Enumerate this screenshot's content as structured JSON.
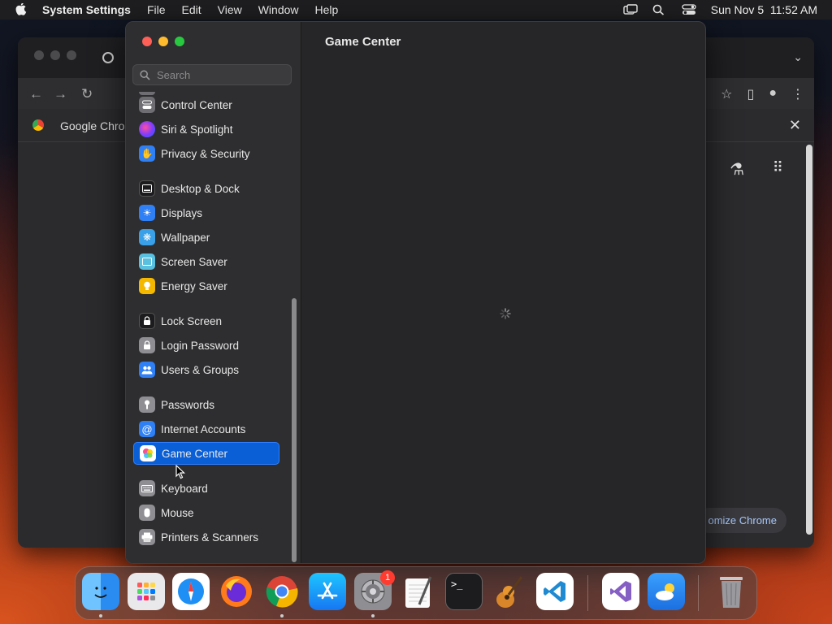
{
  "menubar": {
    "app_name": "System Settings",
    "menus": [
      "File",
      "Edit",
      "View",
      "Window",
      "Help"
    ],
    "datetime": "Sun Nov 5  11:52 AM"
  },
  "chrome": {
    "bookmark_label": "Google Chron",
    "customize_label": "omize Chrome"
  },
  "settings": {
    "search_placeholder": "Search",
    "page_title": "Game Center",
    "sidebar": [
      {
        "label": "Control Center",
        "icon": "control-center-icon",
        "color": "#6e6e73"
      },
      {
        "label": "Siri & Spotlight",
        "icon": "siri-icon",
        "color": "#b048d8"
      },
      {
        "label": "Privacy & Security",
        "icon": "hand-icon",
        "color": "#2f7ff5"
      },
      {
        "label": "Desktop & Dock",
        "icon": "dock-icon",
        "color": "#1c1c1e"
      },
      {
        "label": "Displays",
        "icon": "sun-icon",
        "color": "#2f7ff5"
      },
      {
        "label": "Wallpaper",
        "icon": "wallpaper-icon",
        "color": "#3aa0e8"
      },
      {
        "label": "Screen Saver",
        "icon": "screen-saver-icon",
        "color": "#5ac0e0"
      },
      {
        "label": "Energy Saver",
        "icon": "lightbulb-icon",
        "color": "#f5b800"
      },
      {
        "label": "Lock Screen",
        "icon": "lock-icon",
        "color": "#1c1c1e"
      },
      {
        "label": "Login Password",
        "icon": "padlock-icon",
        "color": "#8e8e93"
      },
      {
        "label": "Users & Groups",
        "icon": "users-icon",
        "color": "#2f7ff5"
      },
      {
        "label": "Passwords",
        "icon": "key-icon",
        "color": "#8e8e93"
      },
      {
        "label": "Internet Accounts",
        "icon": "at-icon",
        "color": "#2f7ff5"
      },
      {
        "label": "Game Center",
        "icon": "game-center-icon",
        "color": "#ffffff"
      },
      {
        "label": "Keyboard",
        "icon": "keyboard-icon",
        "color": "#8e8e93"
      },
      {
        "label": "Mouse",
        "icon": "mouse-icon",
        "color": "#8e8e93"
      },
      {
        "label": "Printers & Scanners",
        "icon": "printer-icon",
        "color": "#8e8e93"
      }
    ],
    "selected": "Game Center"
  },
  "dock": {
    "apps": [
      "Finder",
      "Launchpad",
      "Safari",
      "Firefox",
      "Chrome",
      "App Store",
      "System Settings",
      "TextEdit",
      "Terminal",
      "GarageBand",
      "Visual Studio Code",
      "Visual Studio",
      "Weather",
      "Trash"
    ],
    "settings_badge": "1"
  }
}
